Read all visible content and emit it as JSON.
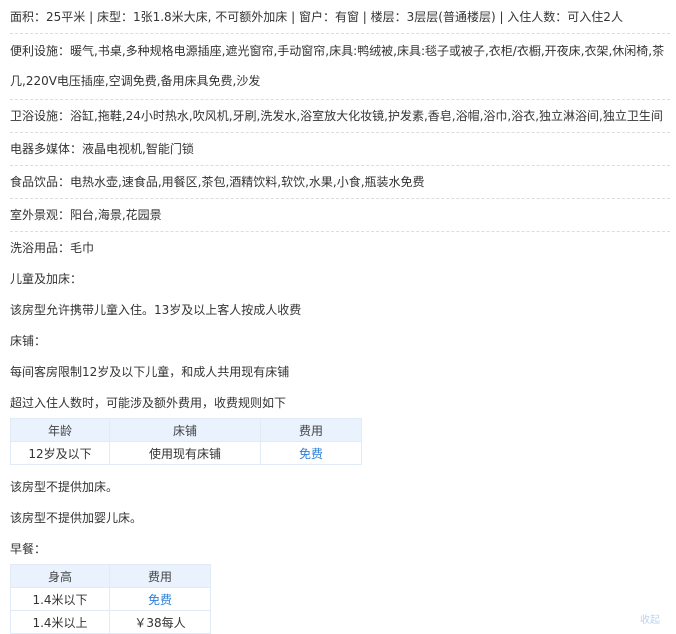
{
  "room": {
    "basic_info": "面积：25平米 | 床型：1张1.8米大床, 不可额外加床 | 窗户：有窗 | 楼层：3层层(普通楼层) | 入住人数：可入住2人",
    "facilities": [
      {
        "label": "便利设施：",
        "value": "暖气,书桌,多种规格电源插座,遮光窗帘,手动窗帘,床具:鸭绒被,床具:毯子或被子,衣柜/衣橱,开夜床,衣架,休闲椅,茶几,220V电压插座,空调免费,备用床具免费,沙发"
      },
      {
        "label": "卫浴设施：",
        "value": "浴缸,拖鞋,24小时热水,吹风机,牙刷,洗发水,浴室放大化妆镜,护发素,香皂,浴帽,浴巾,浴衣,独立淋浴间,独立卫生间"
      },
      {
        "label": "电器多媒体：",
        "value": "液晶电视机,智能门锁"
      },
      {
        "label": "食品饮品：",
        "value": "电热水壶,速食品,用餐区,茶包,酒精饮料,软饮,水果,小食,瓶装水免费"
      },
      {
        "label": "室外景观：",
        "value": "阳台,海景,花园景"
      },
      {
        "label": "洗浴用品：",
        "value": "毛巾"
      }
    ]
  },
  "policy": {
    "children_title": "儿童及加床：",
    "children_text": "该房型允许携带儿童入住。13岁及以上客人按成人收费",
    "bed_title": "床铺：",
    "bed_limit": "每间客房限制12岁及以下儿童，和成人共用现有床铺",
    "bed_extra": "超过入住人数时，可能涉及额外费用，收费规则如下",
    "bed_table": {
      "headers": [
        "年龄",
        "床铺",
        "费用"
      ],
      "rows": [
        [
          "12岁及以下",
          "使用现有床铺",
          "免费"
        ]
      ]
    },
    "no_extra_bed": "该房型不提供加床。",
    "no_crib": "该房型不提供加婴儿床。",
    "breakfast_title": "早餐：",
    "breakfast_table": {
      "headers": [
        "身高",
        "费用"
      ],
      "rows": [
        [
          "1.4米以下",
          "免费"
        ],
        [
          "1.4米以上",
          "￥38每人"
        ]
      ]
    }
  },
  "colors": {
    "free_link": "#2e7fd8",
    "table_header_bg": "#e9f2fd",
    "divider": "#dddddd"
  },
  "corner_text": "收起"
}
